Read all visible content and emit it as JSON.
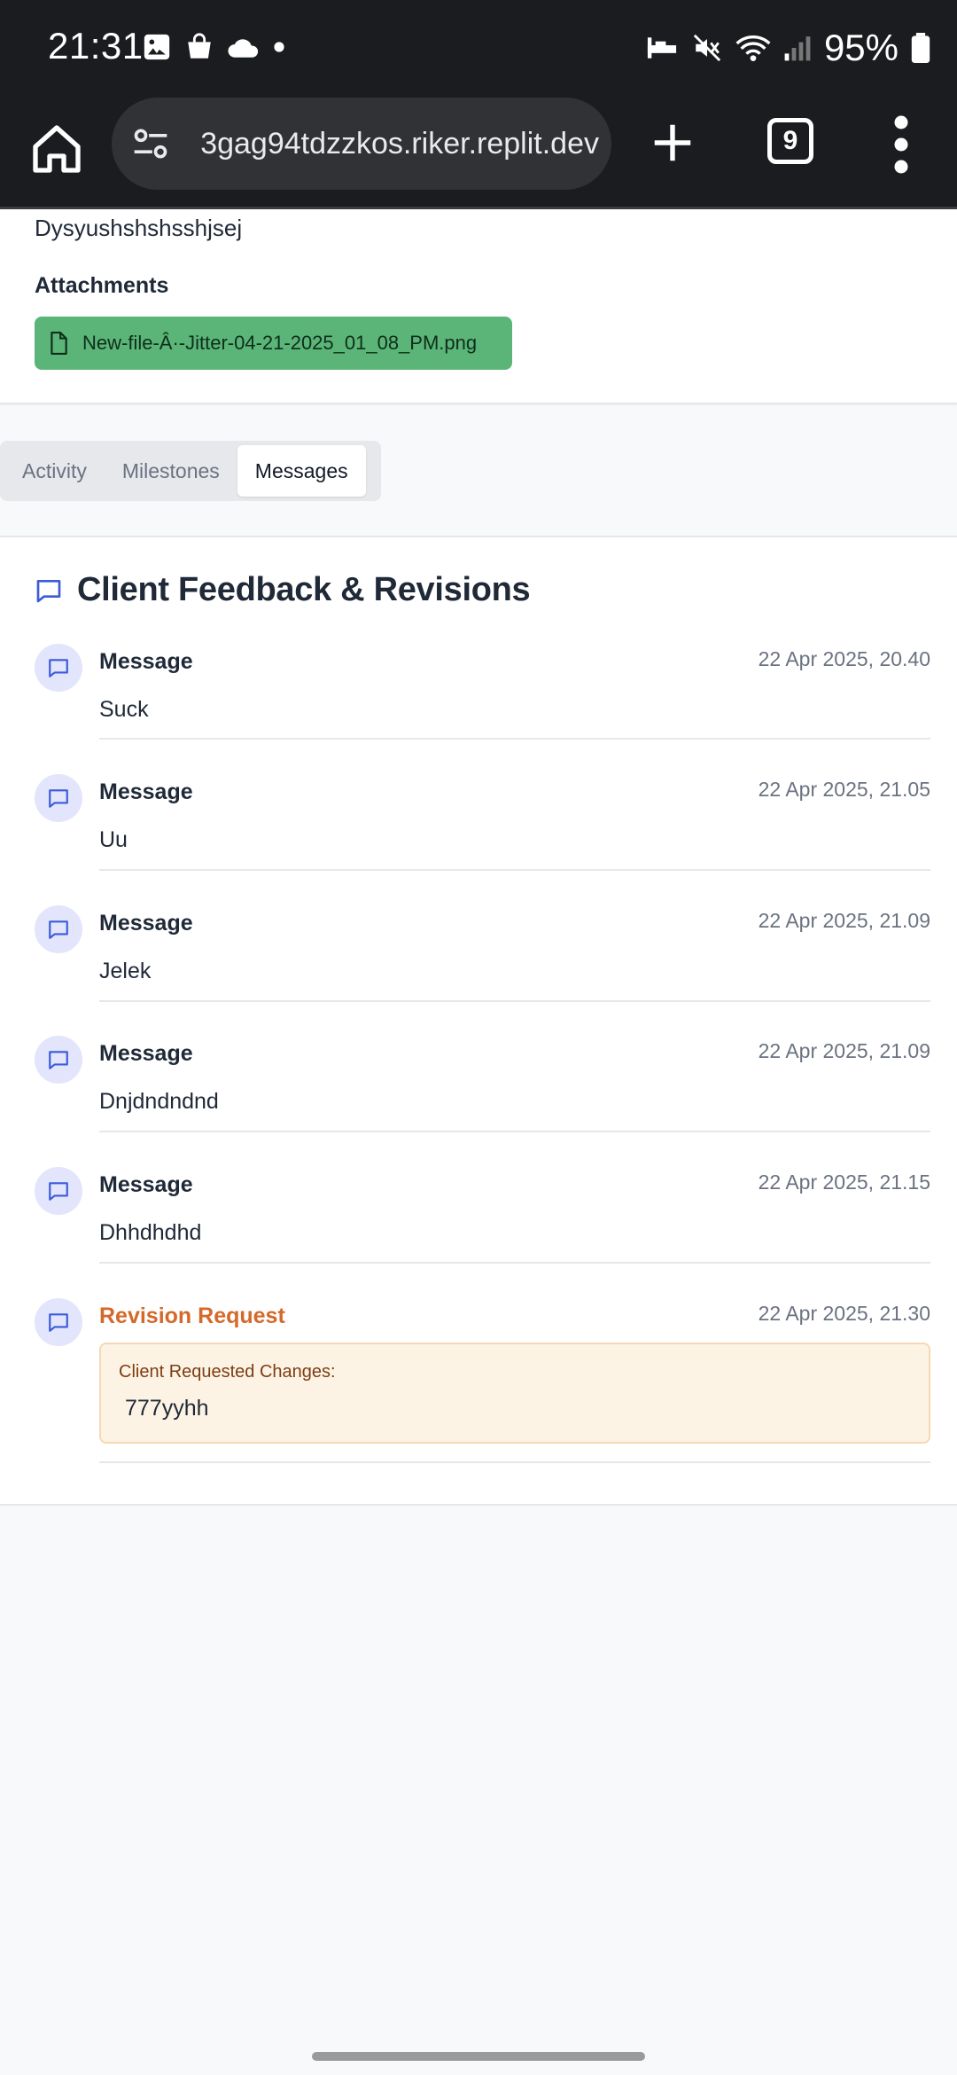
{
  "status_bar": {
    "time": "21:31",
    "battery": "95%"
  },
  "browser": {
    "url": "3gag94tdzzkos.riker.replit.dev",
    "tab_count": "9"
  },
  "project": {
    "description": "Dysyushshshsshjsej",
    "attachments_title": "Attachments",
    "attachments": [
      {
        "name": "New-file-Â·-Jitter-04-21-2025_01_08_PM.png"
      }
    ]
  },
  "tabs": [
    {
      "label": "Activity"
    },
    {
      "label": "Milestones"
    },
    {
      "label": "Messages"
    }
  ],
  "messages_card": {
    "title": "Client Feedback & Revisions",
    "messages": [
      {
        "type": "Message",
        "timestamp": "22 Apr 2025, 20.40",
        "text": "Suck"
      },
      {
        "type": "Message",
        "timestamp": "22 Apr 2025, 21.05",
        "text": "Uu"
      },
      {
        "type": "Message",
        "timestamp": "22 Apr 2025, 21.09",
        "text": "Jelek"
      },
      {
        "type": "Message",
        "timestamp": "22 Apr 2025, 21.09",
        "text": "Dnjdndndnd"
      },
      {
        "type": "Message",
        "timestamp": "22 Apr 2025, 21.15",
        "text": "Dhhdhdhd"
      }
    ],
    "revision": {
      "type": "Revision Request",
      "timestamp": "22 Apr 2025, 21.30",
      "label": "Client Requested Changes:",
      "text": "777yyhh"
    }
  },
  "colors": {
    "accent_blue": "#3b5bdb",
    "attachment_green": "#5bb578",
    "revision_orange": "#d4692a",
    "revision_bg": "#fdf3e5"
  }
}
